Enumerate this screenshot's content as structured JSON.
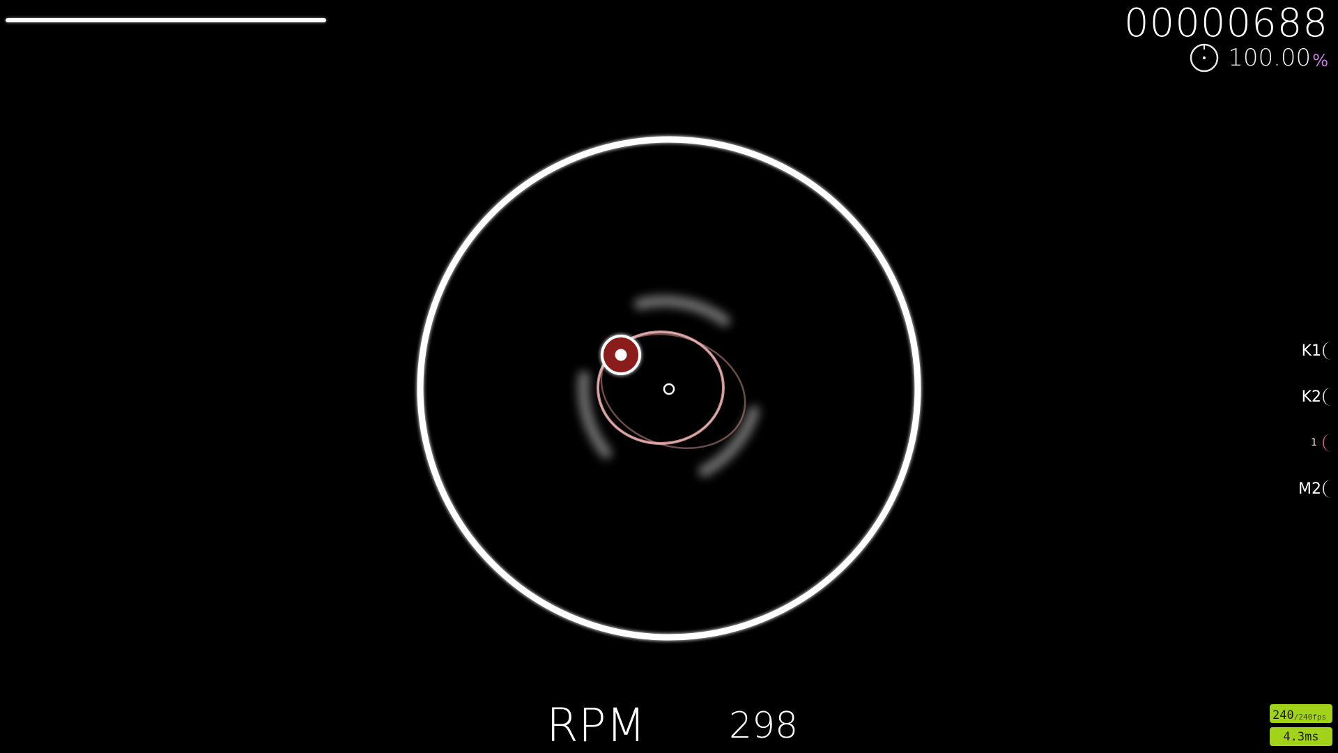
{
  "hud": {
    "health_fraction": 0.49,
    "score": "00000688",
    "accuracy": "100.00",
    "accuracy_suffix": "%",
    "accuracy_suffix_color": "#c77ee6"
  },
  "spinner": {
    "rpm_label": "RPM",
    "rpm_value": "298"
  },
  "key_overlay": {
    "keys": [
      {
        "label": "K1",
        "active": false
      },
      {
        "label": "K2",
        "active": false
      },
      {
        "label": "1",
        "active": true
      },
      {
        "label": "M2",
        "active": false
      }
    ]
  },
  "performance": {
    "fps": "240",
    "fps_limit": "/240fps",
    "frametime": "4.3ms",
    "badge_color": "#a2d21a"
  },
  "colors": {
    "cursor_fill": "#8b1a1a",
    "cursor_trail": "#e8a0a0"
  }
}
